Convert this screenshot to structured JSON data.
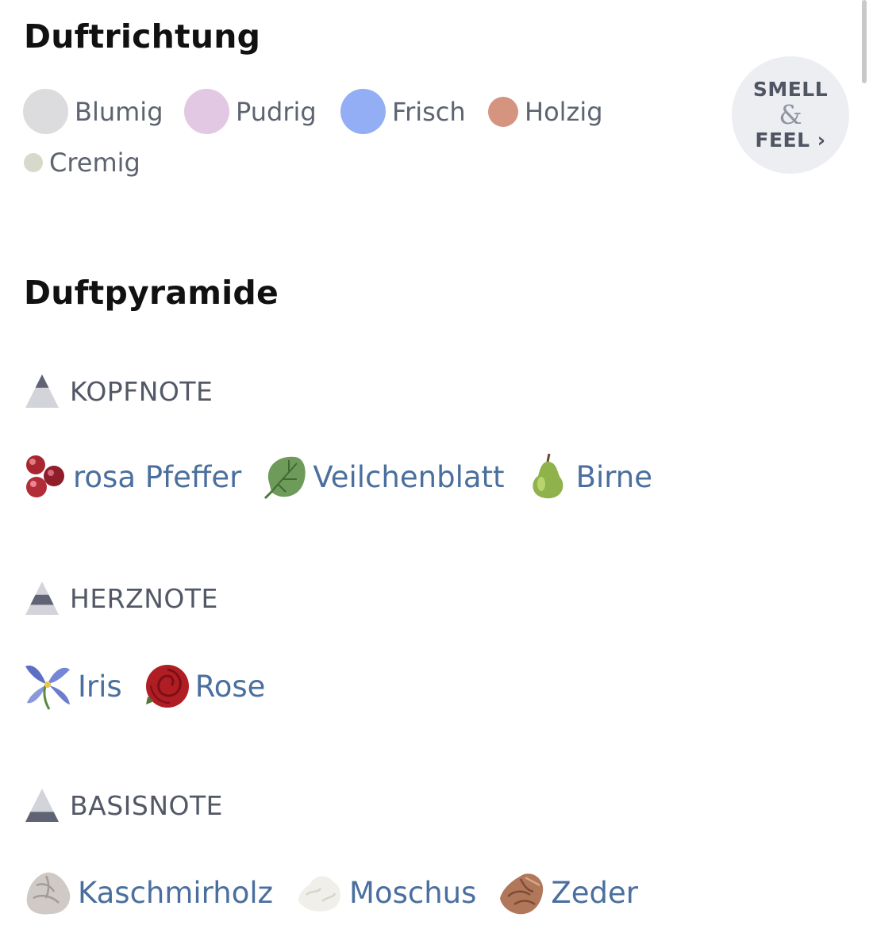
{
  "direction": {
    "title": "Duftrichtung",
    "legend": [
      {
        "label": "Blumig",
        "color": "#dcdcde"
      },
      {
        "label": "Pudrig",
        "color": "#e2c8e2"
      },
      {
        "label": "Frisch",
        "color": "#94aef5"
      },
      {
        "label": "Holzig",
        "color": "#d49480"
      },
      {
        "label": "Cremig",
        "color": "#d7dacb"
      }
    ],
    "smell_feel": {
      "line1": "SMELL",
      "amp": "&",
      "line2": "FEEL ›"
    }
  },
  "pyramid": {
    "title": "Duftpyramide",
    "notes": [
      {
        "label": "KOPFNOTE",
        "ingredients": [
          {
            "name": "rosa Pfeffer",
            "icon": "pink-pepper-icon"
          },
          {
            "name": "Veilchenblatt",
            "icon": "violet-leaf-icon"
          },
          {
            "name": "Birne",
            "icon": "pear-icon"
          }
        ]
      },
      {
        "label": "HERZNOTE",
        "ingredients": [
          {
            "name": "Iris",
            "icon": "iris-icon"
          },
          {
            "name": "Rose",
            "icon": "rose-icon"
          }
        ]
      },
      {
        "label": "BASISNOTE",
        "ingredients": [
          {
            "name": "Kaschmirholz",
            "icon": "cashmere-wood-icon"
          },
          {
            "name": "Moschus",
            "icon": "musk-icon"
          },
          {
            "name": "Zeder",
            "icon": "cedar-icon"
          }
        ]
      }
    ]
  }
}
